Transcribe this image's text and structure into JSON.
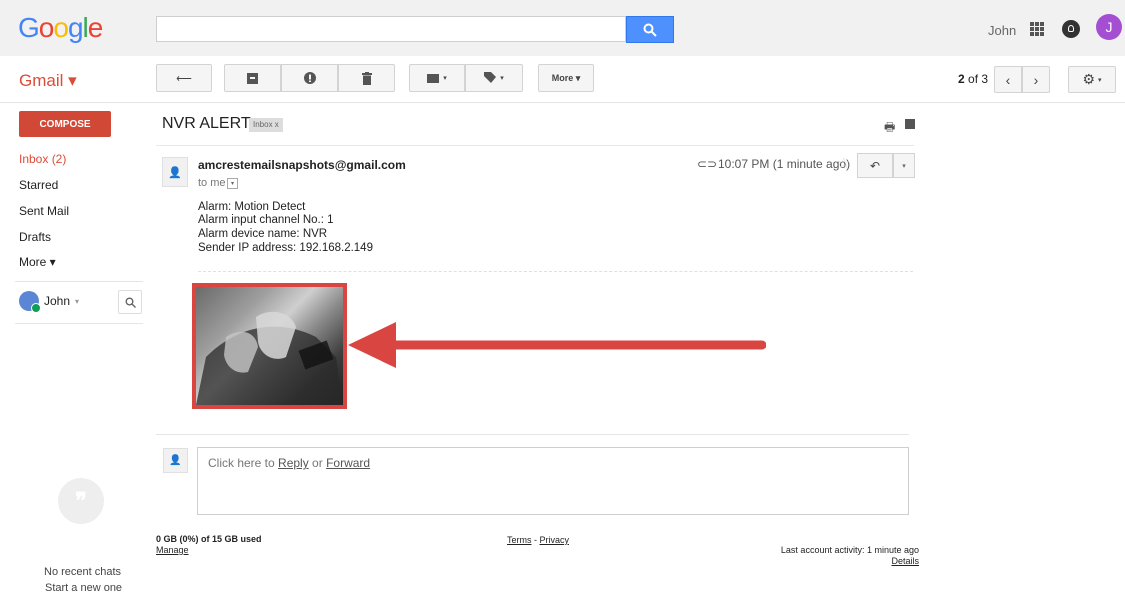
{
  "header": {
    "logo_letters": [
      {
        "ch": "G",
        "color": "#4285f4"
      },
      {
        "ch": "o",
        "color": "#ea4335"
      },
      {
        "ch": "o",
        "color": "#fbbc05"
      },
      {
        "ch": "g",
        "color": "#4285f4"
      },
      {
        "ch": "l",
        "color": "#34a853"
      },
      {
        "ch": "e",
        "color": "#ea4335"
      }
    ],
    "search_value": "",
    "user_name": "John",
    "avatar_letter": "J"
  },
  "toolbar": {
    "app_label": "Gmail ▾",
    "more_label": "More ▾",
    "paging_current": "2",
    "paging_text": " of 3"
  },
  "sidebar": {
    "compose_label": "COMPOSE",
    "items": [
      {
        "label": "Inbox (2)",
        "active": true
      },
      {
        "label": "Starred",
        "active": false
      },
      {
        "label": "Sent Mail",
        "active": false
      },
      {
        "label": "Drafts",
        "active": false
      },
      {
        "label": "More ▾",
        "active": false
      }
    ],
    "chat_user": "John",
    "no_recent_chats": "No recent chats",
    "start_new": "Start a new one"
  },
  "message": {
    "subject": "NVR ALERT",
    "label_tag": "Inbox  x",
    "sender": "amcrestemailsnapshots@gmail.com",
    "to": "to me",
    "time": "10:07 PM (1 minute ago)",
    "body_lines": [
      "Alarm: Motion Detect",
      "Alarm input channel No.: 1",
      "Alarm device name: NVR",
      "Sender IP address: 192.168.2.149"
    ]
  },
  "reply": {
    "prefix": "Click here to ",
    "reply_link": "Reply",
    "or_text": " or ",
    "forward_link": "Forward"
  },
  "footer": {
    "storage": "0 GB (0%) of 15 GB used",
    "manage": "Manage",
    "terms": "Terms",
    "dash": " - ",
    "privacy": "Privacy",
    "last_activity": "Last account activity: 1 minute ago",
    "details": "Details"
  },
  "colors": {
    "brand_red": "#dd4b39",
    "compose_bg": "#d14836",
    "search_blue": "#4d90fe",
    "arrow_red": "#d94540",
    "avatar_purple": "#a44fd1"
  }
}
